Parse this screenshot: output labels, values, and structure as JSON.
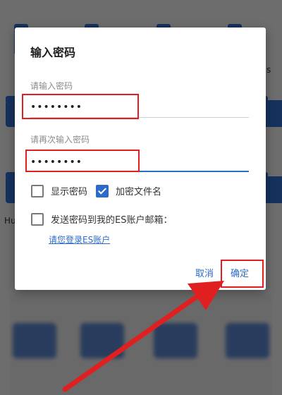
{
  "background": {
    "side_text_right": "s",
    "side_text_left": "Hu"
  },
  "dialog": {
    "title": "输入密码",
    "password_label": "请输入密码",
    "password_value": "••••••••",
    "confirm_label": "请再次输入密码",
    "confirm_value": "••••••••",
    "show_password_label": "显示密码",
    "show_password_checked": false,
    "encrypt_filename_label": "加密文件名",
    "encrypt_filename_checked": true,
    "send_to_email_label": "发送密码到我的ES账户邮箱：",
    "send_to_email_checked": false,
    "login_link": "请您登录ES账户",
    "cancel_label": "取消",
    "ok_label": "确定"
  },
  "colors": {
    "accent": "#2d6bc8",
    "annotation": "#e02020"
  },
  "icons": [
    "checkbox-empty-icon",
    "checkbox-checked-icon"
  ]
}
